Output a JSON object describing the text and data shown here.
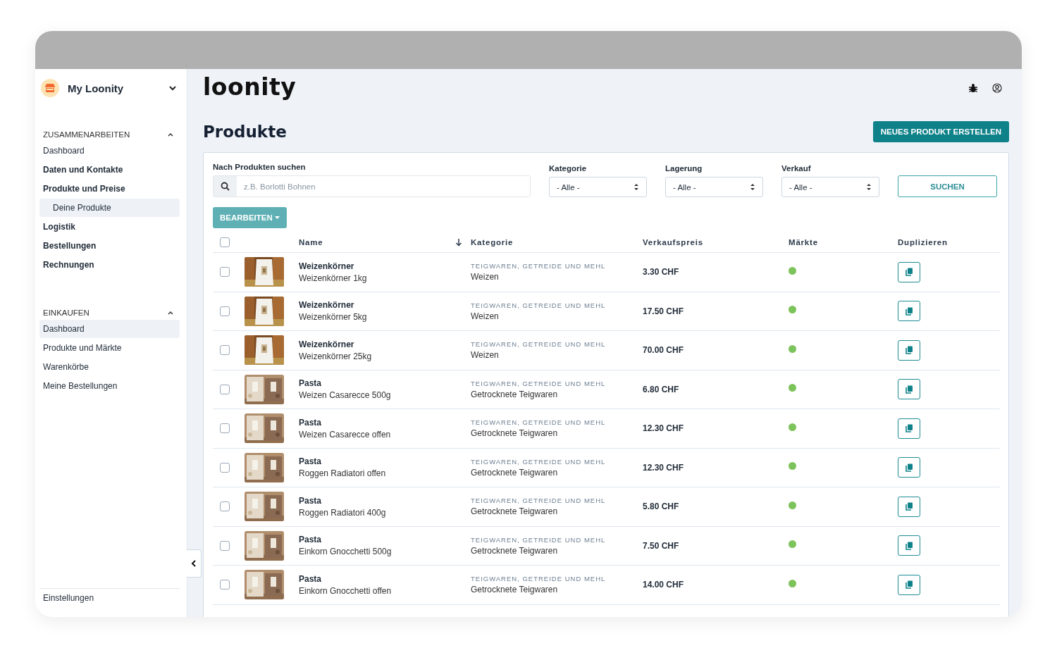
{
  "sidebar": {
    "workspace": "My Loonity",
    "sections": [
      {
        "title": "ZUSAMMENARBEITEN",
        "expanded": true,
        "items": [
          {
            "label": "Dashboard",
            "kind": "link",
            "selected": false
          },
          {
            "label": "Daten und Kontakte",
            "kind": "group",
            "selected": false
          },
          {
            "label": "Produkte und Preise",
            "kind": "group",
            "selected": false,
            "children": [
              {
                "label": "Deine Produkte",
                "selected": true
              }
            ]
          },
          {
            "label": "Logistik",
            "kind": "group",
            "selected": false
          },
          {
            "label": "Bestellungen",
            "kind": "group",
            "selected": false
          },
          {
            "label": "Rechnungen",
            "kind": "group",
            "selected": false
          }
        ]
      },
      {
        "title": "EINKAUFEN",
        "expanded": true,
        "items": [
          {
            "label": "Dashboard",
            "kind": "link",
            "selected": true
          },
          {
            "label": "Produkte und Märkte",
            "kind": "link",
            "selected": false
          },
          {
            "label": "Warenkörbe",
            "kind": "link",
            "selected": false
          },
          {
            "label": "Meine Bestellungen",
            "kind": "link",
            "selected": false
          }
        ]
      }
    ],
    "footer": "Einstellungen"
  },
  "header": {
    "logo": "loonity"
  },
  "page": {
    "title": "Produkte",
    "create_button": "NEUES PRODUKT ERSTELLEN"
  },
  "filters": {
    "search": {
      "label": "Nach Produkten suchen",
      "placeholder": "z.B. Borlotti Bohnen"
    },
    "selects": [
      {
        "label": "Kategorie",
        "value": "- Alle -"
      },
      {
        "label": "Lagerung",
        "value": "- Alle -"
      },
      {
        "label": "Verkauf",
        "value": "- Alle -"
      }
    ],
    "search_button": "SUCHEN"
  },
  "edit_button": "BEARBEITEN",
  "table": {
    "all_checked": false,
    "columns": [
      "Name",
      "Kategorie",
      "Verkaufspreis",
      "Märkte",
      "Duplizieren"
    ],
    "rows": [
      {
        "checked": false,
        "name": "Weizenkörner",
        "variant": "Weizenkörner 1kg",
        "category": "TEIGWAREN, GETREIDE UND MEHL",
        "subcategory": "Weizen",
        "price": "3.30 CHF",
        "color": "#7dc35b"
      },
      {
        "checked": false,
        "name": "Weizenkörner",
        "variant": "Weizenkörner 5kg",
        "category": "TEIGWAREN, GETREIDE UND MEHL",
        "subcategory": "Weizen",
        "price": "17.50 CHF",
        "color": "#7dc35b"
      },
      {
        "checked": false,
        "name": "Weizenkörner",
        "variant": "Weizenkörner 25kg",
        "category": "TEIGWAREN, GETREIDE UND MEHL",
        "subcategory": "Weizen",
        "price": "70.00 CHF",
        "color": "#7dc35b"
      },
      {
        "checked": false,
        "name": "Pasta",
        "variant": "Weizen Casarecce 500g",
        "category": "TEIGWAREN, GETREIDE UND MEHL",
        "subcategory": "Getrocknete Teigwaren",
        "price": "6.80 CHF",
        "color": "#7dc35b"
      },
      {
        "checked": false,
        "name": "Pasta",
        "variant": "Weizen Casarecce offen",
        "category": "TEIGWAREN, GETREIDE UND MEHL",
        "subcategory": "Getrocknete Teigwaren",
        "price": "12.30 CHF",
        "color": "#7dc35b"
      },
      {
        "checked": false,
        "name": "Pasta",
        "variant": "Roggen Radiatori offen",
        "category": "TEIGWAREN, GETREIDE UND MEHL",
        "subcategory": "Getrocknete Teigwaren",
        "price": "12.30 CHF",
        "color": "#7dc35b"
      },
      {
        "checked": false,
        "name": "Pasta",
        "variant": "Roggen Radiatori 400g",
        "category": "TEIGWAREN, GETREIDE UND MEHL",
        "subcategory": "Getrocknete Teigwaren",
        "price": "5.80 CHF",
        "color": "#7dc35b"
      },
      {
        "checked": false,
        "name": "Pasta",
        "variant": "Einkorn Gnocchetti 500g",
        "category": "TEIGWAREN, GETREIDE UND MEHL",
        "subcategory": "Getrocknete Teigwaren",
        "price": "7.50 CHF",
        "color": "#7dc35b"
      },
      {
        "checked": false,
        "name": "Pasta",
        "variant": "Einkorn Gnocchetti offen",
        "category": "TEIGWAREN, GETREIDE UND MEHL",
        "subcategory": "Getrocknete Teigwaren",
        "price": "14.00 CHF",
        "color": "#7dc35b"
      }
    ]
  }
}
